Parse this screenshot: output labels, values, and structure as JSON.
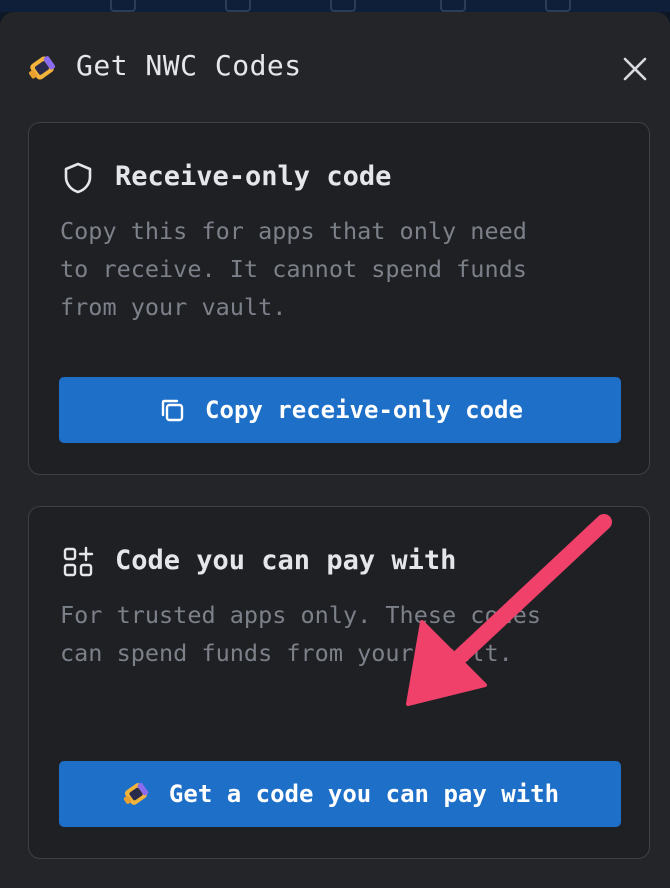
{
  "dialog": {
    "title": "Get NWC Codes",
    "icons": {
      "logo": "nwc-logo-icon",
      "close": "close-icon"
    }
  },
  "receive_card": {
    "title": "Receive-only code",
    "description": "Copy this for apps that only need\nto receive. It cannot spend funds\nfrom your vault.",
    "button_label": "Copy receive-only code",
    "icon": "shield-icon",
    "button_icon": "copy-icon"
  },
  "pay_card": {
    "title": "Code you can pay with",
    "description": "For trusted apps only. These codes\ncan spend funds from your vault.",
    "button_label": "Get a code you can pay with",
    "icon": "apps-add-icon",
    "button_icon": "nwc-logo-icon"
  },
  "colors": {
    "background": "#242528",
    "card_background": "#1f2024",
    "card_border": "#3e4045",
    "primary_button": "#1d6fc8",
    "annotation_arrow": "#f0416b"
  }
}
